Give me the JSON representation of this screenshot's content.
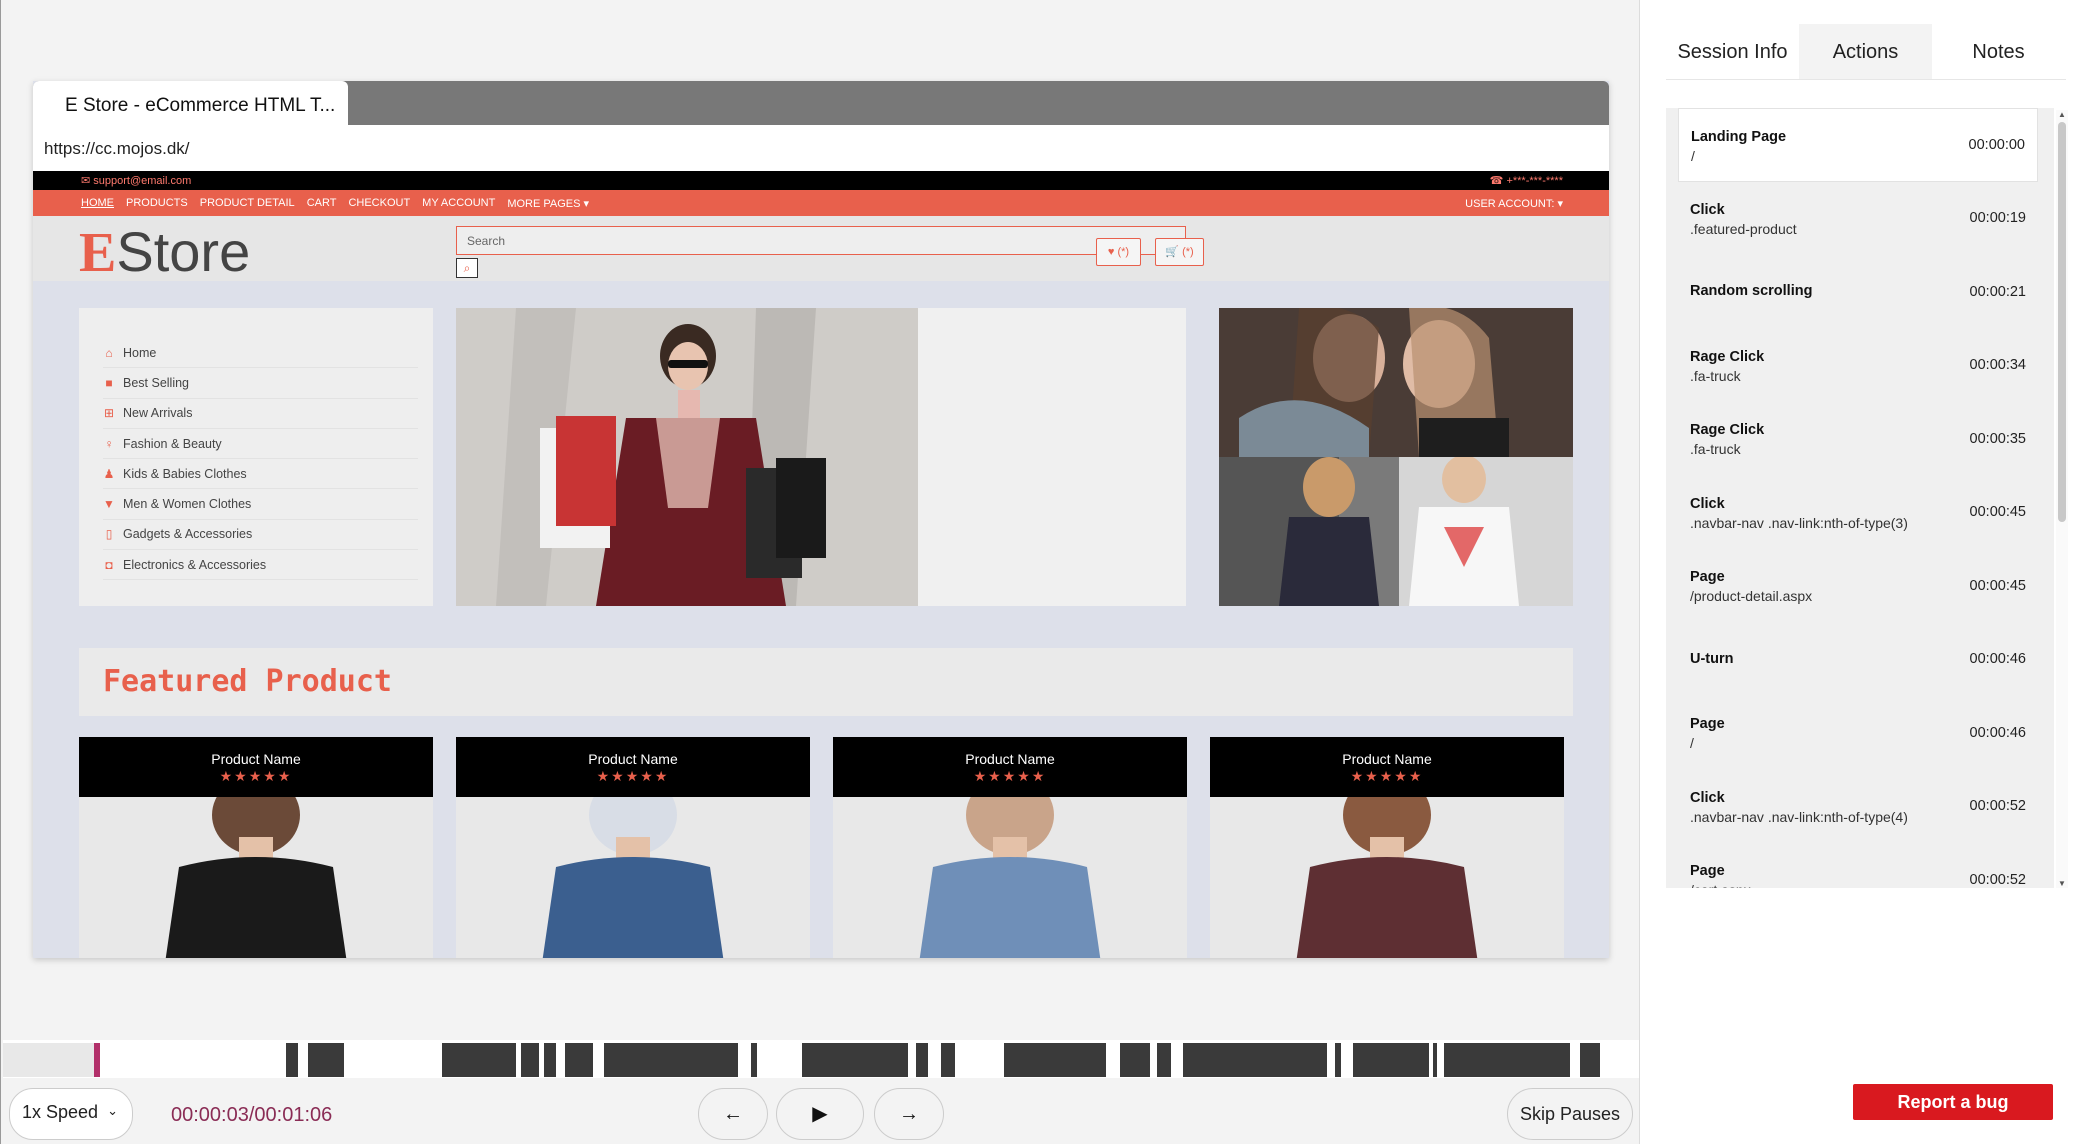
{
  "browser": {
    "tab_title": "E Store - eCommerce HTML T...",
    "url": "https://cc.mojos.dk/"
  },
  "site": {
    "email": "support@email.com",
    "phone": "+***-***-****",
    "nav_links": [
      "HOME",
      "PRODUCTS",
      "PRODUCT DETAIL",
      "CART",
      "CHECKOUT",
      "MY ACCOUNT",
      "MORE PAGES ▾"
    ],
    "user_account": "USER ACCOUNT: ▾",
    "logo_e": "E",
    "logo_rest": "Store",
    "search_placeholder": "Search",
    "wishlist_label": "♥ (*)",
    "cart_label": "🛒 (*)",
    "categories": [
      {
        "label": "Home",
        "icon": "home-icon"
      },
      {
        "label": "Best Selling",
        "icon": "shopping-bag-icon"
      },
      {
        "label": "New Arrivals",
        "icon": "plus-square-icon"
      },
      {
        "label": "Fashion & Beauty",
        "icon": "female-icon"
      },
      {
        "label": "Kids & Babies Clothes",
        "icon": "child-icon"
      },
      {
        "label": "Men & Women Clothes",
        "icon": "tshirt-icon"
      },
      {
        "label": "Gadgets & Accessories",
        "icon": "mobile-icon"
      },
      {
        "label": "Electronics & Accessories",
        "icon": "microchip-icon"
      }
    ],
    "featured_heading": "Featured Product",
    "products": [
      {
        "name": "Product Name",
        "stars": "★★★★★"
      },
      {
        "name": "Product Name",
        "stars": "★★★★★"
      },
      {
        "name": "Product Name",
        "stars": "★★★★★"
      },
      {
        "name": "Product Name",
        "stars": "★★★★★"
      }
    ]
  },
  "player": {
    "speed": "1x Speed",
    "timecode": "00:00:03/00:01:06",
    "skip_pauses": "Skip Pauses",
    "progress_fraction": 0.045
  },
  "panel": {
    "tabs": [
      "Session Info",
      "Actions",
      "Notes"
    ],
    "active_tab": "Actions",
    "actions": [
      {
        "name": "Landing Page",
        "detail": "/",
        "time": "00:00:00"
      },
      {
        "name": "Click",
        "detail": ".featured-product",
        "time": "00:00:19"
      },
      {
        "name": "Random scrolling",
        "detail": "",
        "time": "00:00:21"
      },
      {
        "name": "Rage Click",
        "detail": ".fa-truck",
        "time": "00:00:34"
      },
      {
        "name": "Rage Click",
        "detail": ".fa-truck",
        "time": "00:00:35"
      },
      {
        "name": "Click",
        "detail": ".navbar-nav .nav-link:nth-of-type(3)",
        "time": "00:00:45"
      },
      {
        "name": "Page",
        "detail": "/product-detail.aspx",
        "time": "00:00:45"
      },
      {
        "name": "U-turn",
        "detail": "",
        "time": "00:00:46"
      },
      {
        "name": "Page",
        "detail": "/",
        "time": "00:00:46"
      },
      {
        "name": "Click",
        "detail": ".navbar-nav .nav-link:nth-of-type(4)",
        "time": "00:00:52"
      },
      {
        "name": "Page",
        "detail": "/cart.aspx",
        "time": "00:00:52"
      }
    ],
    "report_bug": "Report a bug"
  },
  "colors": {
    "accent": "#e8604c",
    "timecode": "#8a2c55",
    "report_bug": "#d9191f"
  }
}
